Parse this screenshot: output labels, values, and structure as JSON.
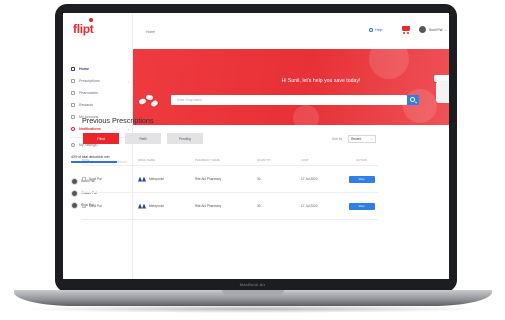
{
  "device": {
    "label": "MacBook Air"
  },
  "app": {
    "brand": "flipt",
    "colors": {
      "brand_red": "#e8262b",
      "accent_blue": "#2f7fe6",
      "nav_blue": "#2d3b8a"
    }
  },
  "sidebar": {
    "items": [
      {
        "label": "Home",
        "icon": "home-icon",
        "active": true
      },
      {
        "label": "Prescriptions",
        "icon": "pill-icon",
        "chevron": true
      },
      {
        "label": "Pharmacies",
        "icon": "pharmacy-icon"
      },
      {
        "label": "Rewards",
        "icon": "gift-icon"
      },
      {
        "label": "My Account",
        "icon": "user-icon"
      },
      {
        "label": "Notifications",
        "icon": "bell-icon",
        "highlight": true,
        "chevron": true
      }
    ],
    "savings_question": "My Savings?",
    "savings_text": "40% of total deductible met",
    "savings_fraction": 0.82,
    "family": [
      "Sunil Pal",
      "Jhulan Pal",
      "Riya Pal"
    ]
  },
  "topbar": {
    "breadcrumb": "Home",
    "help": "Help",
    "user": "Sunil Pal"
  },
  "hero": {
    "greeting": "Hi Sunil, let's help you save today!",
    "search_placeholder": "Enter Drug Name"
  },
  "prescriptions": {
    "title": "Previous Prescriptions",
    "tabs": [
      {
        "label": "Filled",
        "active": true
      },
      {
        "label": "Refill",
        "active": false
      },
      {
        "label": "Pending",
        "active": false
      }
    ],
    "sort_label": "Sort by",
    "sort_value": "Recent",
    "columns": [
      "Date",
      "Drug Name",
      "Pharmacy Name",
      "Quantity",
      "Cost",
      "Action"
    ],
    "rows": [
      {
        "date": "Sunil Pal",
        "drug": "Metoprolol",
        "pharmacy": "Rite Aid Pharmacy",
        "quantity": "30",
        "cost": "17 Jul 2020",
        "action": "View"
      },
      {
        "date": "Sunil Pal",
        "drug": "Metoprolol",
        "pharmacy": "Rite Aid Pharmacy",
        "quantity": "30",
        "cost": "17 Jul 2020",
        "action": "View"
      }
    ]
  }
}
